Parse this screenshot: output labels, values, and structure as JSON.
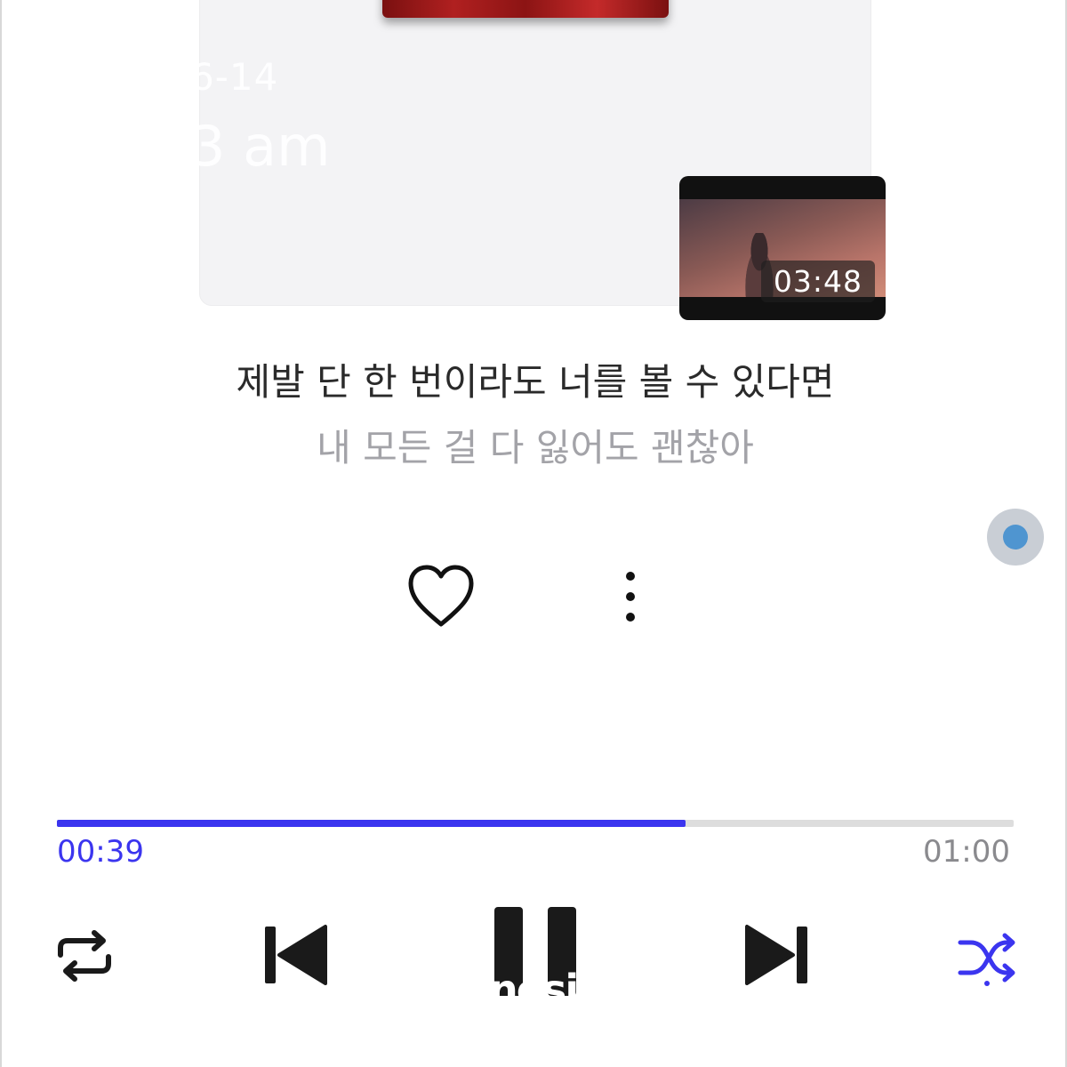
{
  "album": {
    "date_overlay": "6-14",
    "time_overlay": "3 am"
  },
  "video": {
    "duration": "03:48"
  },
  "lyrics": {
    "current": "제발 단 한 번이라도 너를 볼 수 있다면",
    "next": "내 모든 걸 다 잃어도 괜찮아"
  },
  "actions": {
    "like_icon": "heart-icon",
    "more_icon": "more-vertical-icon"
  },
  "playback": {
    "elapsed": "00:39",
    "total": "01:00",
    "progress_fraction": 0.657,
    "accent_color": "#3b35ef"
  },
  "controls": {
    "repeat_icon": "repeat-icon",
    "previous_icon": "skip-previous-icon",
    "pause_icon": "pause-icon",
    "next_icon": "skip-next-icon",
    "shuffle_icon": "shuffle-icon",
    "pause_caption": "nesi"
  }
}
